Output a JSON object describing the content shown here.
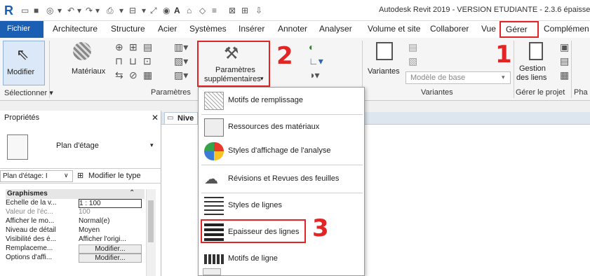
{
  "titlebar": {
    "title": "Autodesk Revit 2019 - VERSION ETUDIANTE - 2.3.6 épaisse",
    "quick_access": [
      "open-icon",
      "save-icon",
      "sync-icon",
      "undo-icon",
      "redo-icon",
      "print-icon",
      "measure-icon",
      "dimension-icon",
      "tag-icon",
      "text-icon",
      "3d-view-icon",
      "section-icon",
      "close-hidden-icon",
      "switch-windows-icon",
      "customize-icon"
    ]
  },
  "menu": {
    "tabs": [
      "Fichier",
      "Architecture",
      "Structure",
      "Acier",
      "Systèmes",
      "Insérer",
      "Annoter",
      "Analyser",
      "Volume et site",
      "Collaborer",
      "Vue",
      "Gérer",
      "Complémen"
    ]
  },
  "ribbon": {
    "modifier": "Modifier",
    "materiaux": "Matériaux",
    "params_line1": "Paramètres",
    "params_line2": "supplémentaires",
    "params_section": "Paramètres",
    "selectionner": "Sélectionner",
    "variantes": "Variantes",
    "modele_de_base": "Modèle de base",
    "variantes_section": "Variantes",
    "gestion_line1": "Gestion",
    "gestion_line2": "des liens",
    "gerer_section": "Gérer le projet",
    "pha": "Pha"
  },
  "callouts": {
    "one": "1",
    "two": "2",
    "three": "3"
  },
  "dropdown": {
    "items": [
      "Motifs de remplissage",
      "Ressources des matériaux",
      "Styles d'affichage de l'analyse",
      "Révisions et Revues des feuilles",
      "Styles de lignes",
      "Epaisseur des lignes",
      "Motifs de ligne"
    ]
  },
  "properties": {
    "title": "Propriétés",
    "type_name": "Plan d'étage",
    "selector": "Plan d'étage: I",
    "edit_type": "Modifier le type",
    "group": "Graphismes",
    "rows": [
      {
        "k": "Echelle de la v...",
        "v": "1 : 100"
      },
      {
        "k": "Valeur de l'éc...",
        "v": "100"
      },
      {
        "k": "Afficher le mo...",
        "v": "Normal(e)"
      },
      {
        "k": "Niveau de détail",
        "v": "Moyen"
      },
      {
        "k": "Visibilité des é...",
        "v": "Afficher l'origi..."
      },
      {
        "k": "Remplaceme...",
        "v": "Modifier..."
      },
      {
        "k": "Options d'affi...",
        "v": "Modifier..."
      }
    ]
  },
  "view": {
    "tab_label": "Nive"
  },
  "colors": {
    "accent": "#1a5fb4",
    "highlight": "#e32424"
  }
}
